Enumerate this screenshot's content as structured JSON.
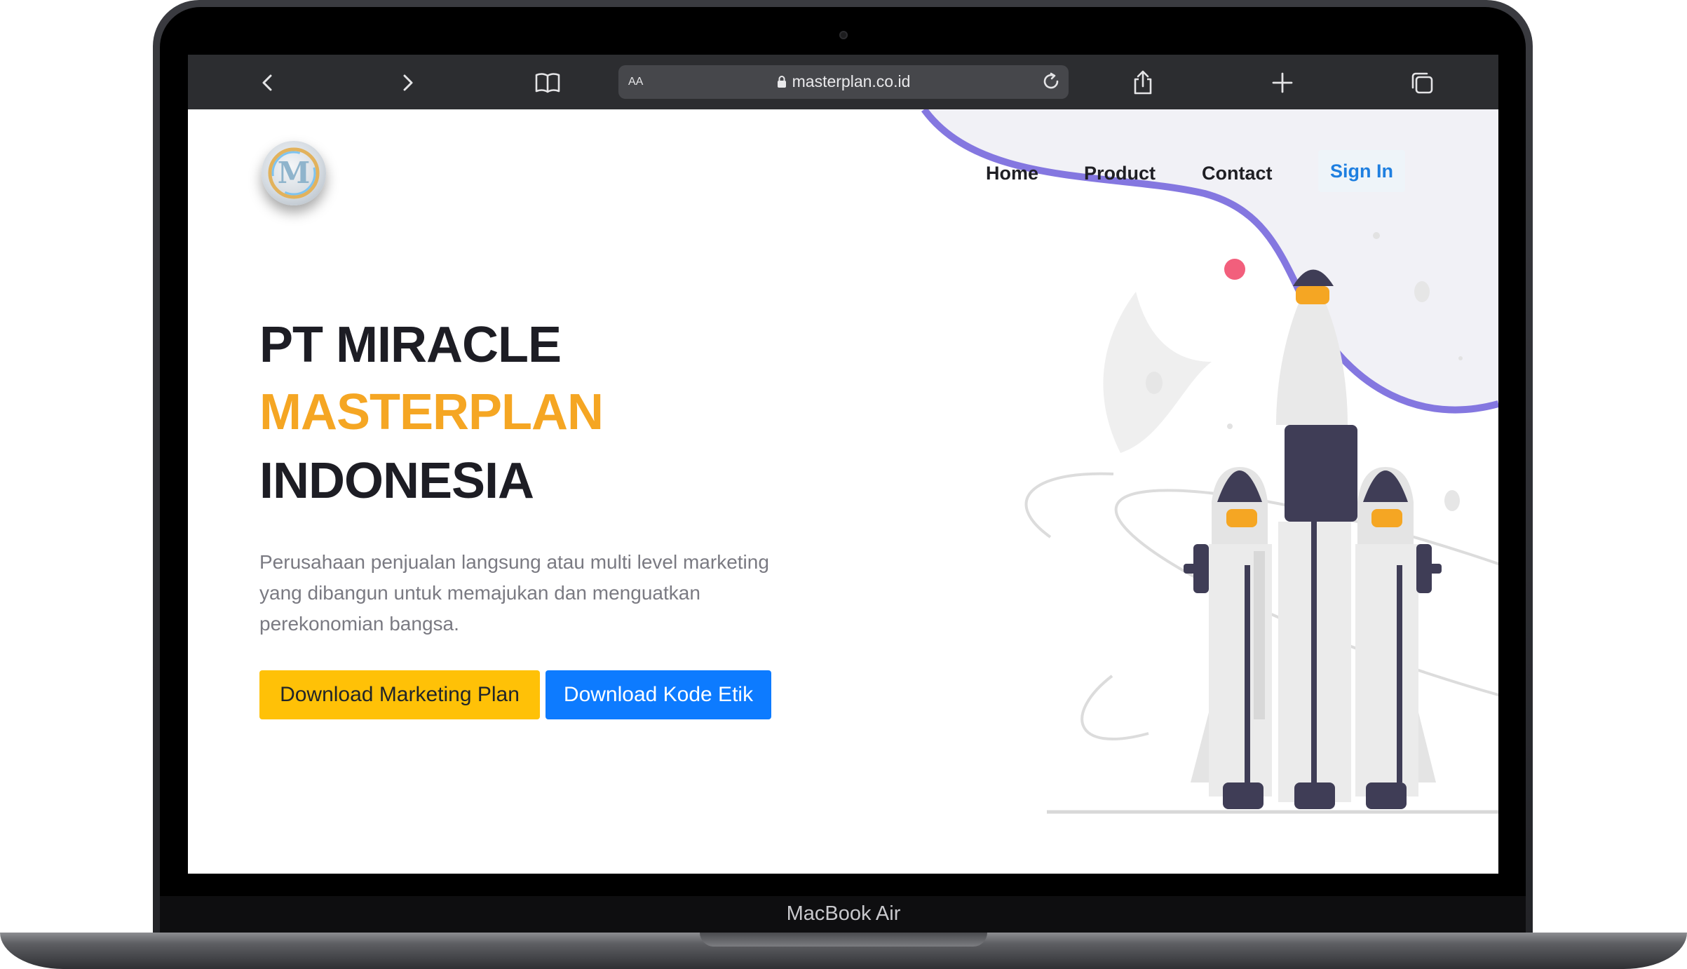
{
  "device": {
    "label": "MacBook Air"
  },
  "browser": {
    "url_prefix": "AA",
    "url": "masterplan.co.id",
    "icons": [
      "back-icon",
      "forward-icon",
      "bookmarks-icon",
      "lock-icon",
      "reload-icon",
      "share-icon",
      "new-tab-icon",
      "tabs-icon"
    ]
  },
  "site": {
    "logo_letter": "M",
    "nav": {
      "home": "Home",
      "product": "Product",
      "contact": "Contact",
      "sign_in": "Sign In"
    },
    "hero": {
      "line1": "PT MIRACLE",
      "line2": "MASTERPLAN",
      "line3": "INDONESIA",
      "description": "Perusahaan penjualan langsung atau multi level marketing yang dibangun untuk memajukan dan menguatkan perekonomian bangsa.",
      "button_marketing": "Download Marketing Plan",
      "button_kode_etik": "Download Kode Etik"
    }
  },
  "colors": {
    "accent_orange": "#f5a623",
    "primary_blue": "#0d7bff",
    "warning_yellow": "#ffc107",
    "purple_wave": "#8477e0",
    "toolbar": "#2c2d30"
  }
}
